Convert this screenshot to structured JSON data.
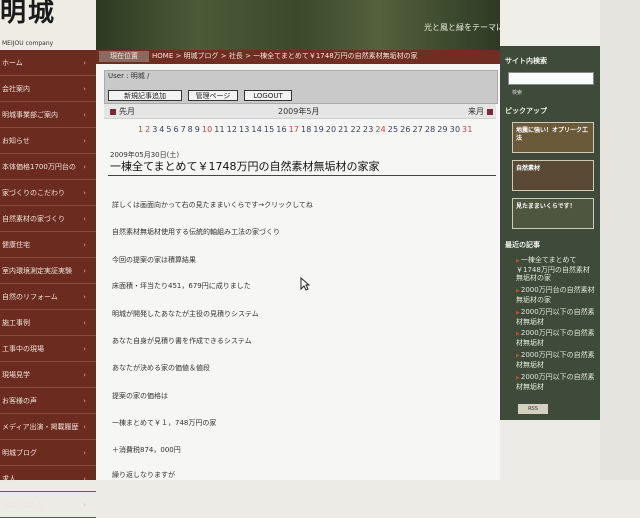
{
  "logo": {
    "main": "明城",
    "sub": "MEIJOU company"
  },
  "header": {
    "tagline": "光と風と緑をテーマに"
  },
  "breadcrumb": {
    "label": "現在位置",
    "path": "HOME > 明城ブログ > 社長 > 一棟全てまとめて￥1748万円の自然素材無垢材の家"
  },
  "left_nav": [
    {
      "label": "ホーム"
    },
    {
      "label": "会社案内"
    },
    {
      "label": "明城事業部ご案内"
    },
    {
      "label": "お知らせ"
    },
    {
      "label": "本体価格1700万円台の"
    },
    {
      "label": "家づくりのこだわり"
    },
    {
      "label": "自然素材の家づくり"
    },
    {
      "label": "健康住宅"
    },
    {
      "label": "室内環境測定実証実験"
    },
    {
      "label": "自然のリフォーム"
    },
    {
      "label": "施工事例"
    },
    {
      "label": "工事中の現場"
    },
    {
      "label": "現場見学"
    },
    {
      "label": "お客様の声"
    },
    {
      "label": "メディア出演・掲載履歴"
    },
    {
      "label": "明城ブログ"
    },
    {
      "label": "求人"
    },
    {
      "label": "お問い合わせ"
    }
  ],
  "userbar": {
    "user": "User : 明城 /",
    "new_post": "新規記事追加",
    "admin": "管理ページ",
    "logout": "LOGOUT"
  },
  "calendar": {
    "prev": "先月",
    "month": "2009年5月",
    "next": "来月",
    "days": [
      {
        "d": "1",
        "c": "#c8443a"
      },
      {
        "d": "2",
        "c": "#c8443a"
      },
      {
        "d": "3",
        "c": "#3a3a6a"
      },
      {
        "d": "4",
        "c": "#3a3a6a"
      },
      {
        "d": "5",
        "c": "#3a3a6a"
      },
      {
        "d": "6",
        "c": "#3a3a6a"
      },
      {
        "d": "7",
        "c": "#3a3a6a"
      },
      {
        "d": "8",
        "c": "#3a3a6a"
      },
      {
        "d": "9",
        "c": "#3a3a6a"
      },
      {
        "d": "10",
        "c": "#c8443a"
      },
      {
        "d": "11",
        "c": "#3a3a6a"
      },
      {
        "d": "12",
        "c": "#3a3a6a"
      },
      {
        "d": "13",
        "c": "#3a3a6a"
      },
      {
        "d": "14",
        "c": "#3a3a6a"
      },
      {
        "d": "15",
        "c": "#3a3a6a"
      },
      {
        "d": "16",
        "c": "#3a3a6a"
      },
      {
        "d": "17",
        "c": "#c8443a"
      },
      {
        "d": "18",
        "c": "#3a3a6a"
      },
      {
        "d": "19",
        "c": "#3a3a6a"
      },
      {
        "d": "20",
        "c": "#3a3a6a"
      },
      {
        "d": "21",
        "c": "#3a3a6a"
      },
      {
        "d": "22",
        "c": "#3a3a6a"
      },
      {
        "d": "23",
        "c": "#3a3a6a"
      },
      {
        "d": "24",
        "c": "#c8443a"
      },
      {
        "d": "25",
        "c": "#3a3a6a"
      },
      {
        "d": "26",
        "c": "#3a3a6a"
      },
      {
        "d": "27",
        "c": "#3a3a6a"
      },
      {
        "d": "28",
        "c": "#3a3a6a"
      },
      {
        "d": "29",
        "c": "#3a3a6a"
      },
      {
        "d": "30",
        "c": "#3a3a6a"
      },
      {
        "d": "31",
        "c": "#c8443a"
      }
    ]
  },
  "post": {
    "date": "2009年05月30日(土)",
    "title": "一棟全てまとめて￥1748万円の自然素材無垢材の家家",
    "lines": [
      "詳しくは画面向かって右の見たままいくらです→クリックしてね",
      "自然素材無垢材使用する伝統的軸組み工法の家づくり",
      "今回の提案の家は積算結果",
      "床面積・坪当たり451，679円に成りました",
      "明城が開発したあなたが主役の見積りシステム",
      "あなた自身が見積り書を作成できるシステム",
      "あなたが決める家の価値＆値段",
      "提案の家の価格は",
      "一棟まとめて￥１，748万円の家",
      "＋消費税874，000円",
      "繰り返しなりますが"
    ]
  },
  "right": {
    "search_title": "サイト内検索",
    "search_hint": "検索",
    "pickup_title": "ピックアップ",
    "banners": [
      {
        "text": "地震に強い！オプリーク工法"
      },
      {
        "text": "自然素材"
      },
      {
        "text": "見たままいくらです！"
      }
    ],
    "recent_title": "最近の記事",
    "articles": [
      "一棟全てまとめて￥1748万円の自然素材無垢材の家",
      "2000万円台の自然素材無垢材の家",
      "2000万円以下の自然素材無垢材",
      "2000万円以下の自然素材無垢材",
      "2000万円以下の自然素材無垢材",
      "2000万円以下の自然素材無垢材"
    ],
    "rss": "RSS"
  }
}
